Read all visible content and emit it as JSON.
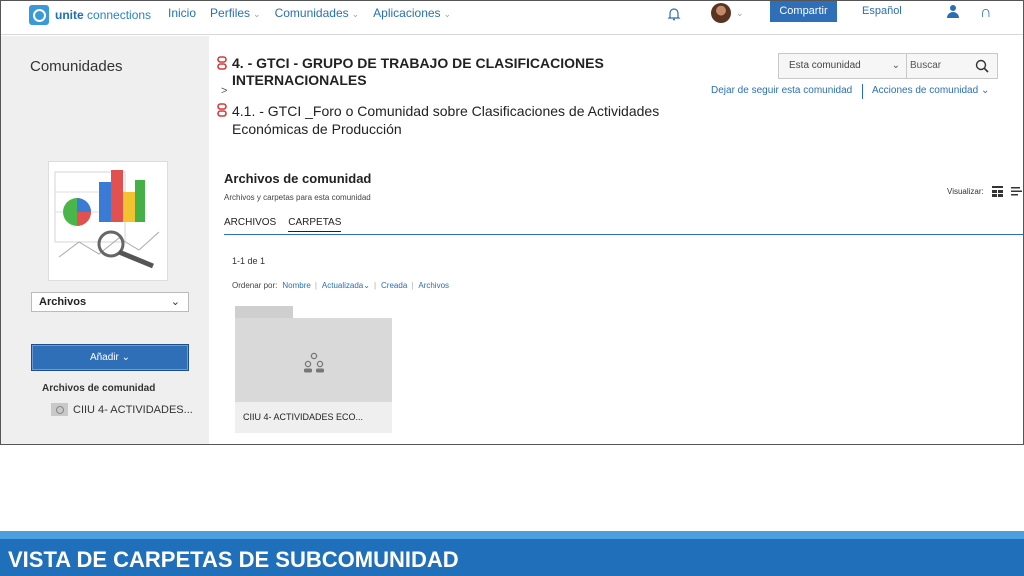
{
  "app": {
    "logo_brand": "unite",
    "logo_product": "connections"
  },
  "topnav": {
    "items": [
      "Inicio",
      "Perfiles",
      "Comunidades",
      "Aplicaciones"
    ],
    "share_label": "Compartir",
    "language": "Español"
  },
  "sidebar": {
    "title": "Comunidades",
    "select_value": "Archivos",
    "add_label": "Añadir",
    "tree_heading": "Archivos de comunidad",
    "tree_item": "CIIU 4- ACTIVIDADES..."
  },
  "header": {
    "crumb1": "4. - GTCI - GRUPO DE TRABAJO DE CLASIFICACIONES INTERNACIONALES",
    "crumb_sep": ">",
    "crumb2": "4.1. - GTCI _Foro o Comunidad sobre Clasificaciones de Actividades Económicas de Producción",
    "search_scope": "Esta comunidad",
    "search_placeholder": "Buscar",
    "unfollow": "Dejar de seguir esta comunidad",
    "actions": "Acciones de comunidad"
  },
  "files": {
    "title": "Archivos de comunidad",
    "subtitle": "Archivos y carpetas para esta comunidad",
    "visualize_label": "Visualizar:",
    "tabs": [
      "ARCHIVOS",
      "CARPETAS"
    ],
    "count": "1-1 de 1",
    "sort_label": "Ordenar por:",
    "sort_options": [
      "Nombre",
      "Actualizada",
      "Creada",
      "Archivos"
    ],
    "folder_name": "CIIU 4- ACTIVIDADES ECO..."
  },
  "banner": {
    "text": "VISTA DE CARPETAS DE SUBCOMUNIDAD"
  },
  "colors": {
    "accent": "#2f6fb8",
    "banner": "#1f6fba",
    "link": "#2a6fb5"
  },
  "icons": [
    "unite-logo-icon",
    "bell-icon",
    "user-icon",
    "search-icon",
    "grid-view-icon",
    "list-view-icon",
    "folder-icon",
    "community-icon"
  ]
}
